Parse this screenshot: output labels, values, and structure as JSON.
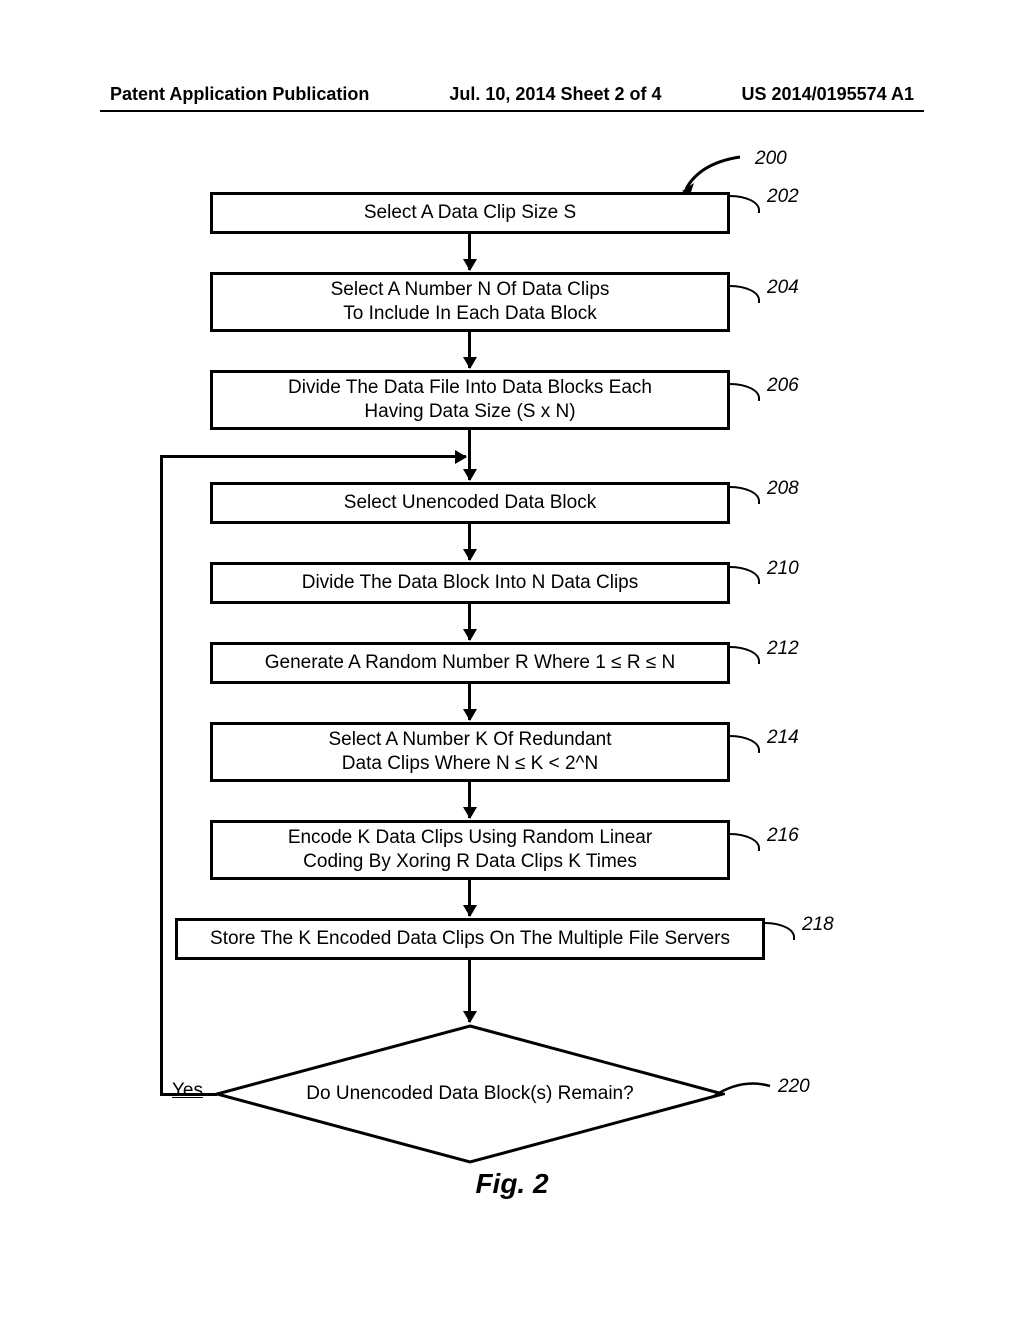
{
  "header": {
    "left": "Patent Application Publication",
    "center": "Jul. 10, 2014   Sheet 2 of 4",
    "right": "US 2014/0195574 A1"
  },
  "labels": {
    "n200": "200",
    "n202": "202",
    "n204": "204",
    "n206": "206",
    "n208": "208",
    "n210": "210",
    "n212": "212",
    "n214": "214",
    "n216": "216",
    "n218": "218",
    "n220": "220"
  },
  "boxes": {
    "b202": "Select A Data Clip Size S",
    "b204_l1": "Select A Number N Of Data Clips",
    "b204_l2": "To Include In Each Data Block",
    "b206_l1": "Divide The  Data File Into Data Blocks Each",
    "b206_l2": "Having Data Size (S x N)",
    "b208": "Select Unencoded Data Block",
    "b210": "Divide The Data Block Into N Data Clips",
    "b212": "Generate A Random Number R Where 1 ≤ R ≤ N",
    "b214_l1": "Select A Number K Of Redundant",
    "b214_l2": "Data Clips Where N ≤ K < 2^N",
    "b216_l1": "Encode K Data Clips Using Random Linear",
    "b216_l2": "Coding By Xoring R Data Clips K Times",
    "b218": "Store The K Encoded Data Clips On The Multiple File Servers",
    "d220": "Do Unencoded Data Block(s) Remain?"
  },
  "branch": {
    "yes": "Yes"
  },
  "figure": "Fig. 2",
  "chart_data": {
    "type": "flowchart",
    "title": "Fig. 2",
    "nodes": [
      {
        "id": "200",
        "type": "label",
        "text": "200"
      },
      {
        "id": "202",
        "type": "process",
        "text": "Select A Data Clip Size S"
      },
      {
        "id": "204",
        "type": "process",
        "text": "Select A Number N Of Data Clips To Include In Each Data Block"
      },
      {
        "id": "206",
        "type": "process",
        "text": "Divide The Data File Into Data Blocks Each Having Data Size (S x N)"
      },
      {
        "id": "208",
        "type": "process",
        "text": "Select Unencoded Data Block"
      },
      {
        "id": "210",
        "type": "process",
        "text": "Divide The Data Block Into N Data Clips"
      },
      {
        "id": "212",
        "type": "process",
        "text": "Generate A Random Number R Where 1 ≤ R ≤ N"
      },
      {
        "id": "214",
        "type": "process",
        "text": "Select A Number K Of Redundant Data Clips Where N ≤ K < 2^N"
      },
      {
        "id": "216",
        "type": "process",
        "text": "Encode K Data Clips Using Random Linear Coding By Xoring R Data Clips K Times"
      },
      {
        "id": "218",
        "type": "process",
        "text": "Store The K Encoded Data Clips On The Multiple File Servers"
      },
      {
        "id": "220",
        "type": "decision",
        "text": "Do Unencoded Data Block(s) Remain?"
      }
    ],
    "edges": [
      {
        "from": "202",
        "to": "204"
      },
      {
        "from": "204",
        "to": "206"
      },
      {
        "from": "206",
        "to": "208"
      },
      {
        "from": "208",
        "to": "210"
      },
      {
        "from": "210",
        "to": "212"
      },
      {
        "from": "212",
        "to": "214"
      },
      {
        "from": "214",
        "to": "216"
      },
      {
        "from": "216",
        "to": "218"
      },
      {
        "from": "218",
        "to": "220"
      },
      {
        "from": "220",
        "to": "208",
        "label": "Yes"
      }
    ]
  }
}
